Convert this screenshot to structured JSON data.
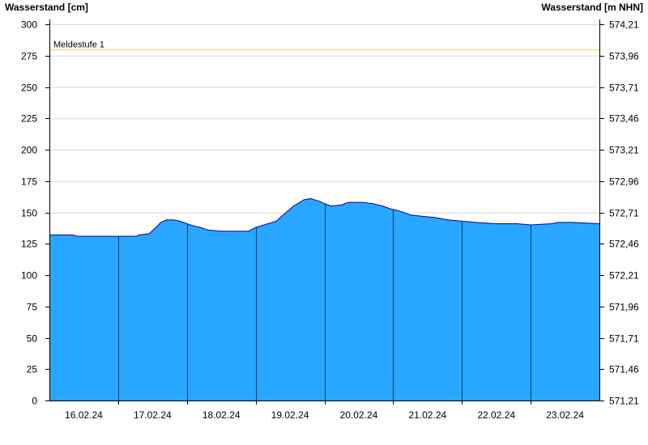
{
  "chart_data": {
    "type": "area",
    "ylabel_left": "Wasserstand [cm]",
    "ylabel_right": "Wasserstand [m NHN]",
    "ylim": [
      0,
      300
    ],
    "yticks_left": [
      "0",
      "25",
      "50",
      "75",
      "100",
      "125",
      "150",
      "175",
      "200",
      "225",
      "250",
      "275",
      "300"
    ],
    "yticks_right": [
      "571,21",
      "571,46",
      "571,71",
      "571,96",
      "572,21",
      "572,46",
      "572,71",
      "572,96",
      "573,21",
      "573,46",
      "573,71",
      "573,96",
      "574,21"
    ],
    "xlim": [
      "15.02.24 12:00",
      "23.02.24 12:00"
    ],
    "xticks": [
      "16.02.24",
      "17.02.24",
      "18.02.24",
      "19.02.24",
      "20.02.24",
      "21.02.24",
      "22.02.24",
      "23.02.24"
    ],
    "grid": true,
    "threshold": {
      "label": "Meldestufe 1",
      "value": 280
    },
    "series": [
      {
        "unit": "cm",
        "x_day_offset": [
          0.0,
          0.35,
          0.4,
          1.0,
          1.27,
          1.3,
          1.45,
          1.55,
          1.62,
          1.7,
          1.8,
          1.9,
          2.05,
          2.12,
          2.2,
          2.3,
          2.5,
          2.7,
          2.9,
          3.0,
          3.3,
          3.4,
          3.55,
          3.7,
          3.8,
          3.92,
          4.0,
          4.1,
          4.25,
          4.35,
          4.45,
          4.55,
          4.7,
          4.85,
          4.95,
          5.1,
          5.25,
          5.4,
          5.6,
          5.8,
          6.0,
          6.2,
          6.5,
          6.8,
          7.0,
          7.3,
          7.4,
          7.6,
          8.0
        ],
        "y": [
          132,
          132,
          131,
          131,
          131,
          132,
          133,
          138,
          142,
          144,
          144,
          143,
          140,
          139,
          138,
          136,
          135,
          135,
          135,
          138,
          143,
          148,
          155,
          160,
          161,
          159,
          157,
          155,
          156,
          158,
          158,
          158,
          157,
          155,
          153,
          151,
          148,
          147,
          146,
          144,
          143,
          142,
          141,
          141,
          140,
          141,
          142,
          142,
          141
        ],
        "x_origin": "15.02.24 12:00",
        "color": "#29a6ff",
        "line_color": "#0000a0"
      }
    ],
    "colors": {
      "fill": "#29a6ff",
      "line": "#0000a0",
      "grid": "#d8d8d8",
      "threshold": "#f0d060",
      "day_line": "#0a3c78"
    }
  }
}
